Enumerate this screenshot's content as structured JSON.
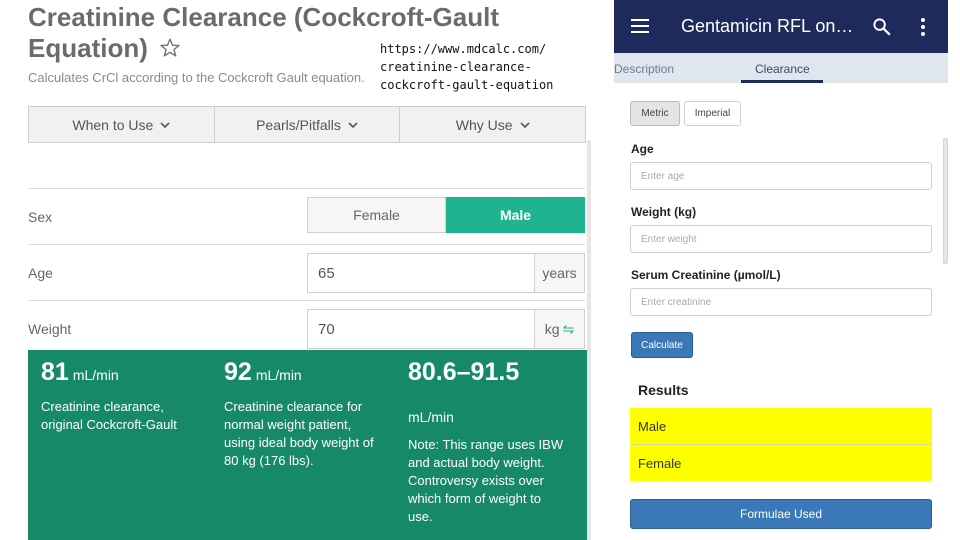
{
  "mdcalc": {
    "title": "Creatinine Clearance (Cockcroft-Gault Equation)",
    "subtitle": "Calculates CrCl according to the Cockcroft Gault equation.",
    "url": "https://www.mdcalc.com/ creatinine-clearance-cockcroft-gault-equation",
    "tabs": [
      {
        "label": "When to Use"
      },
      {
        "label": "Pearls/Pitfalls"
      },
      {
        "label": "Why Use"
      }
    ],
    "sex": {
      "label": "Sex",
      "options": [
        "Female",
        "Male"
      ],
      "selected": "Male"
    },
    "age": {
      "label": "Age",
      "value": "65",
      "unit": "years"
    },
    "weight": {
      "label": "Weight",
      "value": "70",
      "unit": "kg",
      "swap_symbol": "⇋"
    },
    "results": [
      {
        "value": "81",
        "unit": "mL/min",
        "description": "Creatinine clearance, original Cockcroft-Gault"
      },
      {
        "value": "92",
        "unit": "mL/min",
        "description": "Creatinine clearance for normal weight patient, using ideal body weight of 80 kg (176 lbs)."
      },
      {
        "value": "80.6–91.5",
        "unit": "mL/min",
        "description": "Note: This range uses IBW and actual body weight. Controversy exists over which form of weight to use."
      }
    ],
    "colors": {
      "accent": "#1fb38f",
      "results_bg": "#168a66"
    }
  },
  "app": {
    "title": "Gentamicin RFL on…",
    "tabs": [
      {
        "label": "Description"
      },
      {
        "label": "Clearance"
      }
    ],
    "active_tab": "Clearance",
    "unit_buttons": [
      "Metric",
      "Imperial"
    ],
    "active_unit": "Metric",
    "fields": [
      {
        "label": "Age",
        "placeholder": "Enter age"
      },
      {
        "label": "Weight (kg)",
        "placeholder": "Enter weight"
      },
      {
        "label": "Serum Creatinine (µmol/L)",
        "placeholder": "Enter creatinine"
      }
    ],
    "calculate_label": "Calculate",
    "results_title": "Results",
    "result_rows": [
      "Male",
      "Female"
    ],
    "formulae_label": "Formulae Used",
    "colors": {
      "header": "#1e2a5c",
      "button": "#3a78b8",
      "result_highlight": "#ffff00"
    }
  }
}
